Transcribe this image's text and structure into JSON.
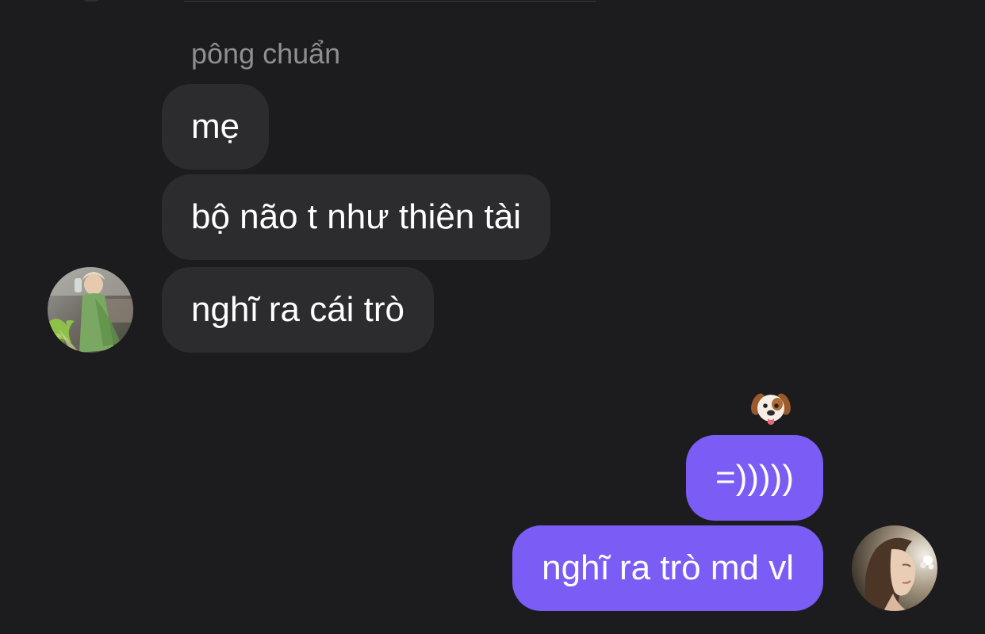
{
  "thread": {
    "sender_name": "pông chuẩn",
    "messages": [
      {
        "direction": "incoming",
        "text": "mẹ"
      },
      {
        "direction": "incoming",
        "text": "bộ não t như thiên tài"
      },
      {
        "direction": "incoming",
        "text": "nghĩ ra cái trò"
      },
      {
        "direction": "outgoing",
        "text": "=)))))",
        "reaction": "dog-face-emoji"
      },
      {
        "direction": "outgoing",
        "text": "nghĩ ra trò md vl"
      }
    ]
  },
  "avatars": {
    "incoming": "contact-photo",
    "outgoing": "own-photo"
  },
  "colors": {
    "background": "#1c1c1e",
    "incoming_bubble": "#2c2c2e",
    "outgoing_bubble": "#7b5cf5",
    "sender_name": "#8e8e93",
    "message_text": "#ffffff"
  }
}
